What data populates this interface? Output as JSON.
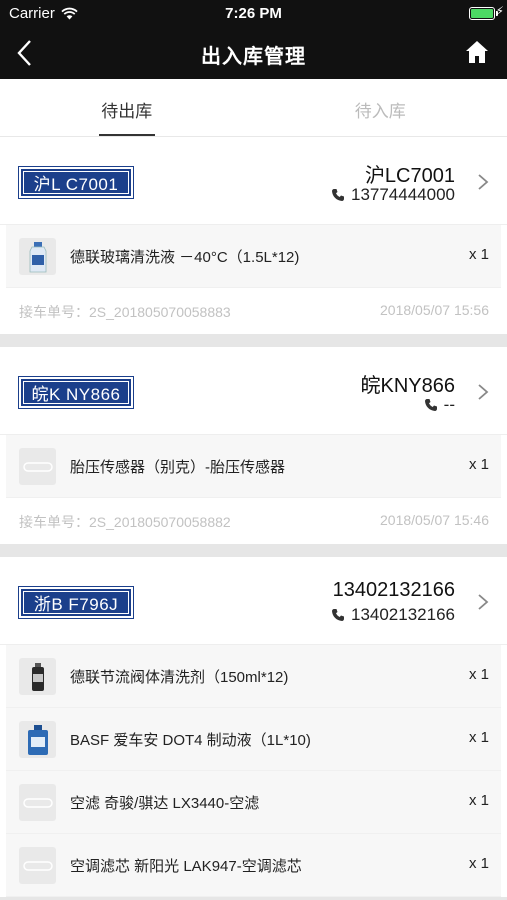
{
  "status_bar": {
    "carrier": "Carrier",
    "time": "7:26 PM"
  },
  "nav": {
    "title": "出入库管理"
  },
  "tabs": [
    {
      "label": "待出库",
      "active": true
    },
    {
      "label": "待入库",
      "active": false
    }
  ],
  "orders": [
    {
      "plate": "沪L C7001",
      "car": "沪LC7001",
      "phone": "13774444000",
      "items": [
        {
          "name": "德联玻璃清洗液 －40°C（1.5L*12)",
          "qty": "x 1",
          "thumb": "washer-fluid-bottle"
        }
      ],
      "order_no": "接车单号：2S_201805070058883",
      "time": "2018/05/07 15:56"
    },
    {
      "plate": "皖K NY866",
      "car": "皖KNY866",
      "phone": "--",
      "items": [
        {
          "name": "胎压传感器（别克）-胎压传感器",
          "qty": "x 1",
          "thumb": "placeholder-image"
        }
      ],
      "order_no": "接车单号：2S_201805070058882",
      "time": "2018/05/07 15:46"
    },
    {
      "plate": "浙B F796J",
      "car": "13402132166",
      "phone": "13402132166",
      "items": [
        {
          "name": "德联节流阀体清洗剂（150ml*12)",
          "qty": "x 1",
          "thumb": "cleaner-can"
        },
        {
          "name": "BASF 爱车安 DOT4 制动液（1L*10)",
          "qty": "x 1",
          "thumb": "brake-fluid-bottle"
        },
        {
          "name": "空滤 奇骏/骐达 LX3440-空滤",
          "qty": "x 1",
          "thumb": "placeholder-image"
        },
        {
          "name": "空调滤芯 新阳光 LAK947-空调滤芯",
          "qty": "x 1",
          "thumb": "placeholder-image"
        }
      ]
    }
  ],
  "colors": {
    "plate_blue": "#1b3f8b",
    "nav_bg": "#111111",
    "battery_green": "#4cd964"
  }
}
